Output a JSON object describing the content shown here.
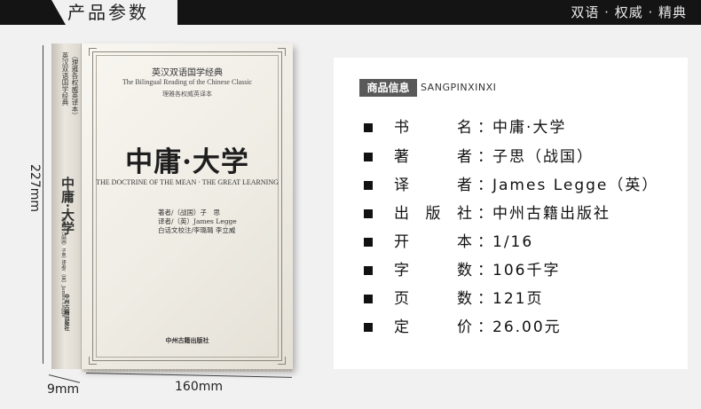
{
  "banner": {
    "tab_title": "产品参数",
    "slogan": "双语 · 权威 · 精典"
  },
  "book": {
    "series_cn": "英汉双语国学经典",
    "series_en": "The Bilingual Reading of the Chinese Classic",
    "edition": "理雅各权威英译本",
    "title_cn": "中庸·大学",
    "title_en": "THE DOCTRINE OF THE MEAN · THE GREAT LEARNING",
    "credits": [
      "著者/（战国）子　思",
      "译者/（英）James Legge",
      "白话文校注/李璐璐  李立威"
    ],
    "publisher": "中州古籍出版社",
    "spine": {
      "series": "英汉双语国学经典",
      "sub": "（理雅各权威英译本）",
      "title": "中庸·大学",
      "credits": "著者/（战国）子思  译者/（英）James Legge",
      "publisher": "中州古籍出版社"
    }
  },
  "dimensions": {
    "height": "227mm",
    "width": "160mm",
    "depth": "9mm"
  },
  "info_panel": {
    "badge": "商品信息",
    "badge_en": "SANGPINXINXI",
    "rows": [
      {
        "label": "书名",
        "value": "中庸·大学"
      },
      {
        "label": "著者",
        "value": "子思（战国）"
      },
      {
        "label": "译者",
        "value": "James Legge（英）"
      },
      {
        "label": "出版社",
        "value": "中州古籍出版社"
      },
      {
        "label": "开本",
        "value": "1/16"
      },
      {
        "label": "字数",
        "value": "106千字"
      },
      {
        "label": "页数",
        "value": "121页"
      },
      {
        "label": "定价",
        "value": "26.00元"
      }
    ],
    "colon": "："
  }
}
